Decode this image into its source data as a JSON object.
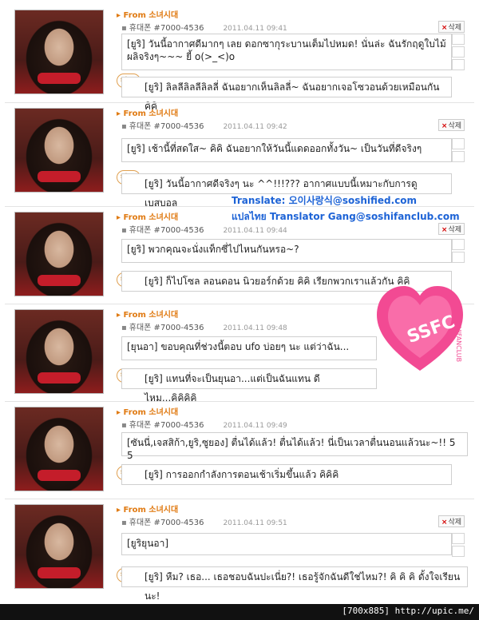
{
  "posts": [
    {
      "from": "From 소녀시대",
      "user": "휴대폰 #7000-4536",
      "date": "2011.04.11 09:41",
      "delete_label": "삭제",
      "message": "[ยูริ] วันนี้อากาศดีมากๆ เลย ดอกซากุระบานเต็มไปหมด! นั่นล่ะ ฉันรักฤดูใบไม้ผลิจริงๆ~~~ ยี้ o(>_<)o",
      "star_label": "star",
      "reply": "[ยูริ] ลิลลีลิลลีลิลลี่ ฉันอยากเห็นลิลลี่~ ฉันอยากเจอโซวอนด้วยเหมือนกัน คิคิ"
    },
    {
      "from": "From 소녀시대",
      "user": "휴대폰 #7000-4536",
      "date": "2011.04.11 09:42",
      "delete_label": "삭제",
      "message": "[ยูริ] เช้านี้ที่สดใส~ คิคิ ฉันอยากให้วันนี้แดดออกทั้งวัน~ เป็นวันที่ดีจริงๆ",
      "star_label": "star",
      "reply": "[ยูริ] วันนี้อากาศดีจริงๆ นะ ^^!!!??? อากาศแบบนี้เหมาะกับการดูเบสบอล"
    },
    {
      "from": "From 소녀시대",
      "user": "휴대폰 #7000-4536",
      "date": "2011.04.11 09:44",
      "delete_label": "삭제",
      "message": "[ยูริ] พวกคุณจะนั่งแท็กซี่ไปไหนกันหรอ~?",
      "star_label": "star",
      "reply": "[ยูริ] ก็ไปโซล ลอนดอน นิวยอร์กด้วย คิคิ เรียกพวกเราแล้วกัน คิคิ"
    },
    {
      "from": "From 소녀시대",
      "user": "휴대폰 #7000-4536",
      "date": "2011.04.11 09:48",
      "delete_label": "삭제",
      "message": "[ยุนอา] ขอบคุณที่ช่วงนี้ตอบ ufo บ่อยๆ นะ แต่ว่าฉัน...",
      "star_label": "star",
      "reply": "[ยูริ] แทนที่จะเป็นยุนอา...แต่เป็นฉันแทน ดีไหม...คิคิคิคิ"
    },
    {
      "from": "From 소녀시대",
      "user": "휴대폰 #7000-4536",
      "date": "2011.04.11 09:49",
      "delete_label": "삭제",
      "message": "[ซันนี่,เจสสิก้า,ยูริ,ซูยอง] ตื่นได้แล้ว! ตื่นได้แล้ว! นี่เป็นเวลาตื่นนอนแล้วนะ~!! 5 5",
      "star_label": "star",
      "reply": "[ยูริ] การออกกำลังการตอนเช้าเริ่มขึ้นแล้ว คิคิคิ"
    },
    {
      "from": "From 소녀시대",
      "user": "휴대폰 #7000-4536",
      "date": "2011.04.11 09:51",
      "delete_label": "삭제",
      "message": "[ยูริยุนอา]",
      "star_label": "star",
      "reply": "[ยูริ] หืม? เธอ... เธอชอบฉันปะเนี่ย?! เธอรู้จักฉันดีใช่ไหม?! คิ คิ คิ ดั้งใจเรียนนะ!"
    }
  ],
  "translate_line1": "Translate: 오이사랑식@soshified.com",
  "translate_line2": "แปลไทย Translator Gang@soshifanclub.com",
  "logo_text": "SSFC",
  "logo_subtext": "SOSHIFANCLUB",
  "footer_text": "[700x885] http://upic.me/"
}
